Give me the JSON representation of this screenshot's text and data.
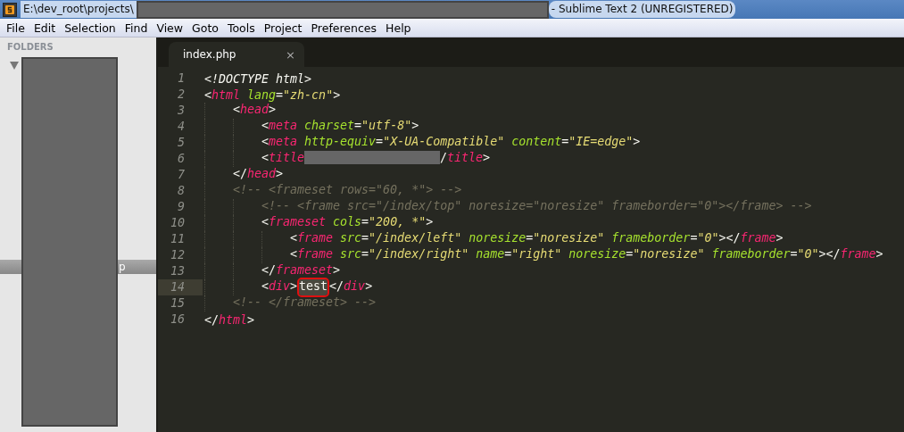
{
  "window": {
    "title_start": "E:\\dev_root\\projects\\",
    "title_end": "- Sublime Text 2 (UNREGISTERED)"
  },
  "menu": [
    {
      "label": "File"
    },
    {
      "label": "Edit"
    },
    {
      "label": "Selection"
    },
    {
      "label": "Find"
    },
    {
      "label": "View"
    },
    {
      "label": "Goto"
    },
    {
      "label": "Tools"
    },
    {
      "label": "Project"
    },
    {
      "label": "Preferences"
    },
    {
      "label": "Help"
    }
  ],
  "sidebar": {
    "heading": "FOLDERS",
    "selected_row_text": "p"
  },
  "tabs": [
    {
      "label": "index.php",
      "close": "×",
      "selected": true
    }
  ],
  "lines": [
    {
      "number": "1",
      "current": false,
      "tokens": [
        {
          "kind": "doctype",
          "text": "<!DOCTYPE html>"
        }
      ]
    },
    {
      "number": "2",
      "current": false,
      "tokens": [
        {
          "kind": "punct",
          "text": "<"
        },
        {
          "kind": "tag",
          "text": "html"
        },
        {
          "kind": "attr",
          "text": " lang"
        },
        {
          "kind": "punct",
          "text": "="
        },
        {
          "kind": "string",
          "text": "\"zh-cn\""
        },
        {
          "kind": "punct",
          "text": ">"
        }
      ],
      "children": [
        {
          "number": "3",
          "current": false,
          "tokens": [
            {
              "kind": "punct",
              "text": "<"
            },
            {
              "kind": "tag",
              "text": "head"
            },
            {
              "kind": "punct",
              "text": ">"
            }
          ],
          "children": [
            {
              "number": "4",
              "current": false,
              "tokens": [
                {
                  "kind": "punct",
                  "text": "<"
                },
                {
                  "kind": "tag",
                  "text": "meta"
                },
                {
                  "kind": "attr",
                  "text": " charset"
                },
                {
                  "kind": "punct",
                  "text": "="
                },
                {
                  "kind": "string",
                  "text": "\"utf-8\""
                },
                {
                  "kind": "punct",
                  "text": ">"
                }
              ]
            },
            {
              "number": "5",
              "current": false,
              "tokens": [
                {
                  "kind": "punct",
                  "text": "<"
                },
                {
                  "kind": "tag",
                  "text": "meta"
                },
                {
                  "kind": "attr",
                  "text": " http-equiv"
                },
                {
                  "kind": "punct",
                  "text": "="
                },
                {
                  "kind": "string",
                  "text": "\"X-UA-Compatible\""
                },
                {
                  "kind": "attr",
                  "text": " content"
                },
                {
                  "kind": "punct",
                  "text": "="
                },
                {
                  "kind": "string",
                  "text": "\"IE=edge\""
                },
                {
                  "kind": "punct",
                  "text": ">"
                }
              ]
            },
            {
              "number": "6",
              "current": false,
              "tokens": [
                {
                  "kind": "punct",
                  "text": "<"
                },
                {
                  "kind": "tag",
                  "text": "title"
                },
                {
                  "kind": "redacted"
                },
                {
                  "kind": "punct",
                  "text": "/"
                },
                {
                  "kind": "tag",
                  "text": "title"
                },
                {
                  "kind": "punct",
                  "text": ">"
                }
              ]
            }
          ]
        },
        {
          "number": "7",
          "current": false,
          "tokens": [
            {
              "kind": "punct",
              "text": "</"
            },
            {
              "kind": "tag",
              "text": "head"
            },
            {
              "kind": "punct",
              "text": ">"
            }
          ]
        },
        {
          "number": "8",
          "current": false,
          "tokens": [
            {
              "kind": "comment",
              "text": "<!-- <frameset rows=\"60, *\"> -->"
            }
          ],
          "children": [
            {
              "number": "9",
              "current": false,
              "tokens": [
                {
                  "kind": "comment",
                  "text": "<!-- <frame src=\"/index/top\" noresize=\"noresize\" frameborder=\"0\"></frame> -->"
                }
              ]
            },
            {
              "number": "10",
              "current": false,
              "tokens": [
                {
                  "kind": "punct",
                  "text": "<"
                },
                {
                  "kind": "tag",
                  "text": "frameset"
                },
                {
                  "kind": "attr",
                  "text": " cols"
                },
                {
                  "kind": "punct",
                  "text": "="
                },
                {
                  "kind": "string",
                  "text": "\"200, *\""
                },
                {
                  "kind": "punct",
                  "text": ">"
                }
              ],
              "children": [
                {
                  "number": "11",
                  "current": false,
                  "tokens": [
                    {
                      "kind": "punct",
                      "text": "<"
                    },
                    {
                      "kind": "tag",
                      "text": "frame"
                    },
                    {
                      "kind": "attr",
                      "text": " src"
                    },
                    {
                      "kind": "punct",
                      "text": "="
                    },
                    {
                      "kind": "string",
                      "text": "\"/index/left\""
                    },
                    {
                      "kind": "attr",
                      "text": " noresize"
                    },
                    {
                      "kind": "punct",
                      "text": "="
                    },
                    {
                      "kind": "string",
                      "text": "\"noresize\""
                    },
                    {
                      "kind": "attr",
                      "text": " frameborder"
                    },
                    {
                      "kind": "punct",
                      "text": "="
                    },
                    {
                      "kind": "string",
                      "text": "\"0\""
                    },
                    {
                      "kind": "punct",
                      "text": "></"
                    },
                    {
                      "kind": "tag",
                      "text": "frame"
                    },
                    {
                      "kind": "punct",
                      "text": ">"
                    }
                  ]
                },
                {
                  "number": "12",
                  "current": false,
                  "tokens": [
                    {
                      "kind": "punct",
                      "text": "<"
                    },
                    {
                      "kind": "tag",
                      "text": "frame"
                    },
                    {
                      "kind": "attr",
                      "text": " src"
                    },
                    {
                      "kind": "punct",
                      "text": "="
                    },
                    {
                      "kind": "string",
                      "text": "\"/index/right\""
                    },
                    {
                      "kind": "attr",
                      "text": " name"
                    },
                    {
                      "kind": "punct",
                      "text": "="
                    },
                    {
                      "kind": "string",
                      "text": "\"right\""
                    },
                    {
                      "kind": "attr",
                      "text": " noresize"
                    },
                    {
                      "kind": "punct",
                      "text": "="
                    },
                    {
                      "kind": "string",
                      "text": "\"noresize\""
                    },
                    {
                      "kind": "attr",
                      "text": " frameborder"
                    },
                    {
                      "kind": "punct",
                      "text": "="
                    },
                    {
                      "kind": "string",
                      "text": "\"0\""
                    },
                    {
                      "kind": "punct",
                      "text": "></"
                    },
                    {
                      "kind": "tag",
                      "text": "frame"
                    },
                    {
                      "kind": "punct",
                      "text": ">"
                    }
                  ]
                }
              ]
            },
            {
              "number": "13",
              "current": false,
              "tokens": [
                {
                  "kind": "punct",
                  "text": "</"
                },
                {
                  "kind": "tag",
                  "text": "frameset"
                },
                {
                  "kind": "punct",
                  "text": ">"
                }
              ]
            },
            {
              "number": "14",
              "current": true,
              "tokens": [
                {
                  "kind": "punct",
                  "text": "<"
                },
                {
                  "kind": "tag",
                  "text": "div"
                },
                {
                  "kind": "punct",
                  "text": ">"
                },
                {
                  "kind": "selection",
                  "text": "test"
                },
                {
                  "kind": "punct",
                  "text": "</"
                },
                {
                  "kind": "tag",
                  "text": "div"
                },
                {
                  "kind": "punct",
                  "text": ">"
                }
              ]
            }
          ]
        },
        {
          "number": "15",
          "current": false,
          "tokens": [
            {
              "kind": "comment",
              "text": "<!-- </frameset> -->"
            }
          ]
        }
      ]
    },
    {
      "number": "16",
      "current": false,
      "tokens": [
        {
          "kind": "punct",
          "text": "</"
        },
        {
          "kind": "tag",
          "text": "html"
        },
        {
          "kind": "punct",
          "text": ">"
        }
      ]
    }
  ]
}
